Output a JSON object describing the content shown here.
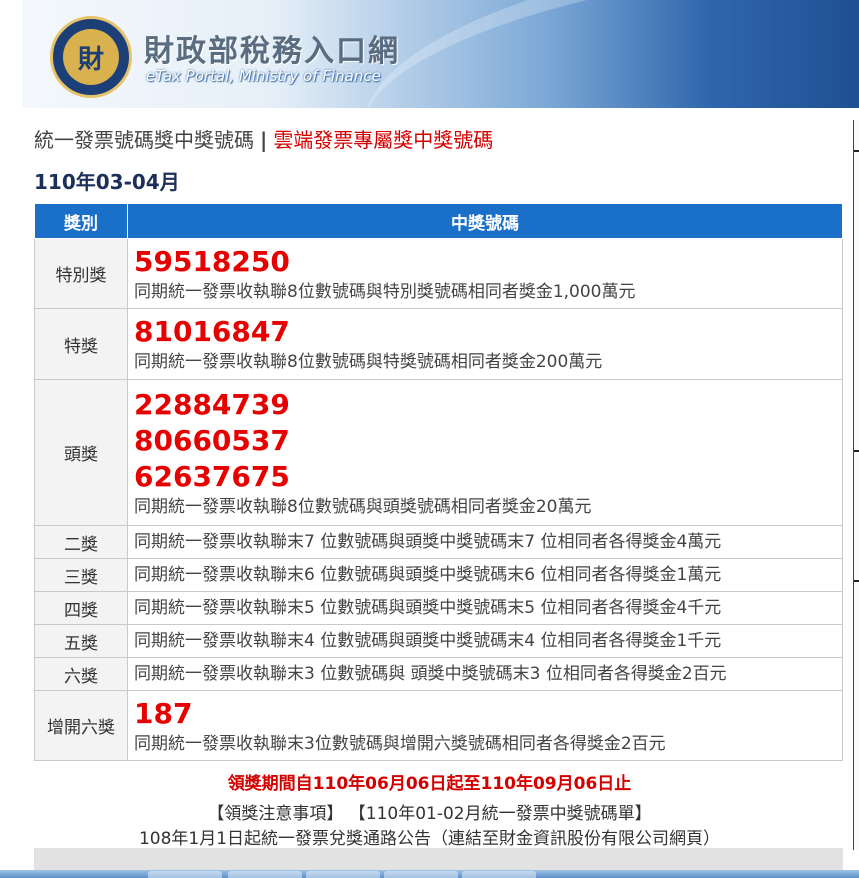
{
  "header": {
    "logo_text": "財",
    "site_title": "財政部稅務入口網",
    "site_subtitle": "eTax Portal, Ministry of Finance"
  },
  "heading": {
    "title": "統一發票號碼獎中獎號碼",
    "separator": "|",
    "cloud_link": "雲端發票專屬獎中獎號碼"
  },
  "period": "110年03-04月",
  "table": {
    "col_category": "獎別",
    "col_numbers": "中獎號碼",
    "rows": [
      {
        "category": "特別獎",
        "numbers": [
          "59518250"
        ],
        "desc": "同期統一發票收執聯8位數號碼與特別獎號碼相同者獎金1,000萬元"
      },
      {
        "category": "特獎",
        "numbers": [
          "81016847"
        ],
        "desc": "同期統一發票收執聯8位數號碼與特獎號碼相同者獎金200萬元"
      },
      {
        "category": "頭獎",
        "numbers": [
          "22884739",
          "80660537",
          "62637675"
        ],
        "desc": "同期統一發票收執聯8位數號碼與頭獎號碼相同者獎金20萬元"
      },
      {
        "category": "二獎",
        "desc": "同期統一發票收執聯末7 位數號碼與頭獎中獎號碼末7 位相同者各得獎金4萬元"
      },
      {
        "category": "三獎",
        "desc": "同期統一發票收執聯末6 位數號碼與頭獎中獎號碼末6 位相同者各得獎金1萬元"
      },
      {
        "category": "四獎",
        "desc": "同期統一發票收執聯末5 位數號碼與頭獎中獎號碼末5 位相同者各得獎金4千元"
      },
      {
        "category": "五獎",
        "desc": "同期統一發票收執聯末4 位數號碼與頭獎中獎號碼末4 位相同者各得獎金1千元"
      },
      {
        "category": "六獎",
        "desc": "同期統一發票收執聯末3 位數號碼與 頭獎中獎號碼末3 位相同者各得獎金2百元"
      },
      {
        "category": "增開六獎",
        "numbers": [
          "187"
        ],
        "desc": "同期統一發票收執聯末3位數號碼與增開六獎號碼相同者各得獎金2百元"
      }
    ]
  },
  "claim_period": "領獎期間自110年06月06日起至110年09月06日止",
  "links": {
    "notice": "【領獎注意事項】",
    "list": "【110年01-02月統一發票中獎號碼單】",
    "channel": "108年1月1日起統一發票兌獎通路公告（連結至財金資訊股份有限公司網頁）"
  },
  "colors": {
    "header_blue": "#1a70c8",
    "prize_red": "#e60000",
    "period_navy": "#1c2e5a"
  }
}
